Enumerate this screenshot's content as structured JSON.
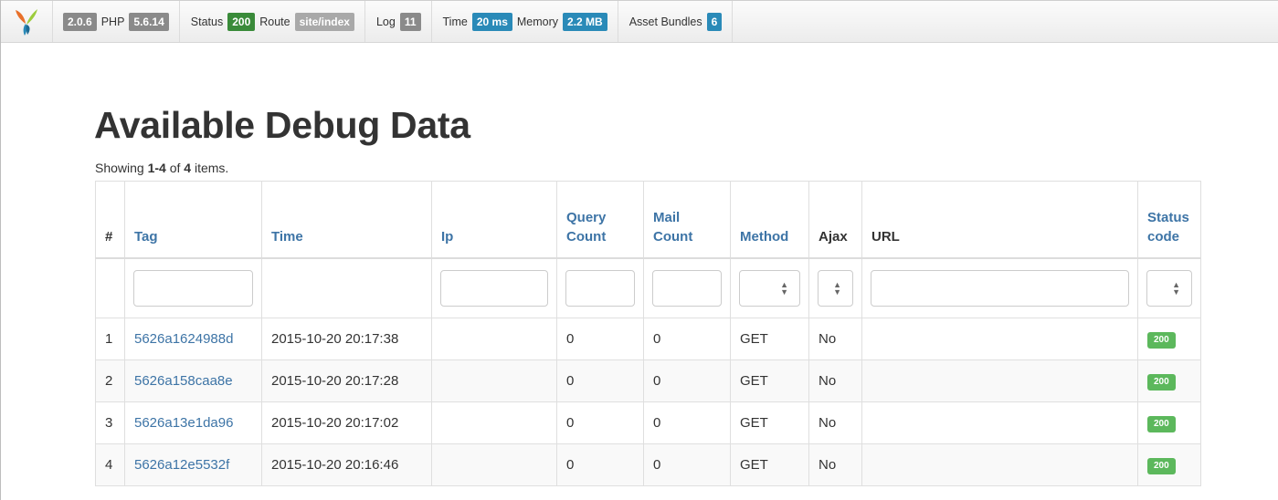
{
  "toolbar": {
    "logo": "yii-logo-icon",
    "yii_version": "2.0.6",
    "php_label": "PHP",
    "php_version": "5.6.14",
    "status_label": "Status",
    "status_value": "200",
    "route_label": "Route",
    "route_value": "site/index",
    "log_label": "Log",
    "log_value": "11",
    "time_label": "Time",
    "time_value": "20 ms",
    "memory_label": "Memory",
    "memory_value": "2.2 MB",
    "assets_label": "Asset Bundles",
    "assets_value": "6"
  },
  "page": {
    "title": "Available Debug Data",
    "summary_prefix": "Showing ",
    "summary_range": "1-4",
    "summary_of": " of ",
    "summary_total": "4",
    "summary_suffix": " items."
  },
  "table": {
    "headers": {
      "num": "#",
      "tag": "Tag",
      "time": "Time",
      "ip": "Ip",
      "query_1": "Query",
      "query_2": "Count",
      "mail_1": "Mail",
      "mail_2": "Count",
      "method": "Method",
      "ajax": "Ajax",
      "url": "URL",
      "status_1": "Status",
      "status_2": "code"
    },
    "rows": [
      {
        "num": "1",
        "tag": "5626a1624988d",
        "time": "2015-10-20 20:17:38",
        "ip": "",
        "query": "0",
        "mail": "0",
        "method": "GET",
        "ajax": "No",
        "url": "",
        "status": "200"
      },
      {
        "num": "2",
        "tag": "5626a158caa8e",
        "time": "2015-10-20 20:17:28",
        "ip": "",
        "query": "0",
        "mail": "0",
        "method": "GET",
        "ajax": "No",
        "url": "",
        "status": "200"
      },
      {
        "num": "3",
        "tag": "5626a13e1da96",
        "time": "2015-10-20 20:17:02",
        "ip": "",
        "query": "0",
        "mail": "0",
        "method": "GET",
        "ajax": "No",
        "url": "",
        "status": "200"
      },
      {
        "num": "4",
        "tag": "5626a12e5532f",
        "time": "2015-10-20 20:16:46",
        "ip": "",
        "query": "0",
        "mail": "0",
        "method": "GET",
        "ajax": "No",
        "url": "",
        "status": "200"
      }
    ]
  }
}
